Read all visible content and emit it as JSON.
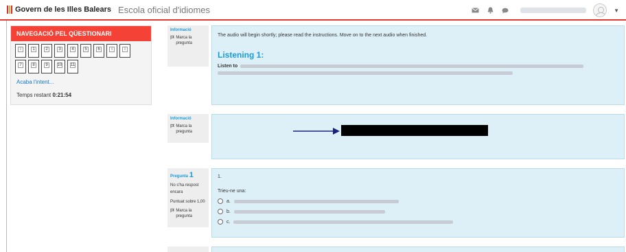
{
  "header": {
    "brand": "Govern de les Illes Balears",
    "site": "Escola oficial d'idiomes",
    "icons": [
      "envelope-icon",
      "bell-icon",
      "chat-icon",
      "user-avatar"
    ]
  },
  "quiz_nav": {
    "title": "NAVEGACIÓ PEL QÜESTIONARI",
    "buttons": [
      "i",
      "1",
      "2",
      "3",
      "4",
      "5",
      "6",
      "i",
      "i",
      "7",
      "8",
      "9",
      "10",
      "11"
    ],
    "finish_label": "Acaba l'intent...",
    "timer_label": "Temps restant",
    "timer_value": "0:21:54"
  },
  "blocks": [
    {
      "info_title": "Informació",
      "flag_label": "Marca la pregunta",
      "lead": "The audio will begin shortly; please read the instructions. Move on to the next audio when finished.",
      "heading": "Listening 1:",
      "listen_label": "Listen to"
    },
    {
      "info_title": "Informació",
      "flag_label": "Marca la pregunta"
    },
    {
      "info_title": "Pregunta",
      "question_number": "1",
      "status": "No s'ha respost encara",
      "score": "Puntuat sobre 1,00",
      "flag_label": "Marca la pregunta",
      "qno": "1.",
      "prompt": "Trieu-ne una:",
      "options": [
        "a.",
        "b.",
        "c."
      ]
    }
  ],
  "colors": {
    "accent": "#f44336",
    "link": "#1a9bd7",
    "content_bg": "#def0f7"
  }
}
